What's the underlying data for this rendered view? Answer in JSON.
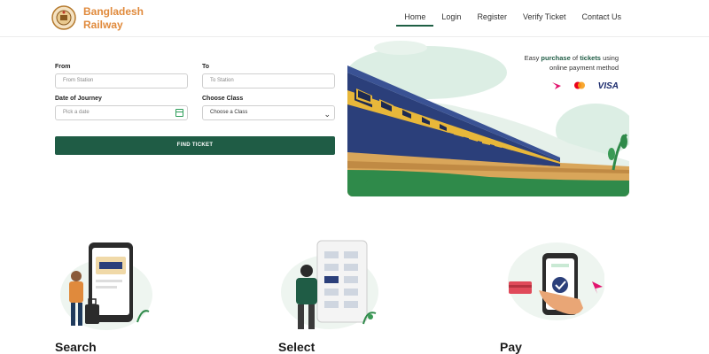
{
  "brand": {
    "line1": "Bangladesh",
    "line2": "Railway"
  },
  "nav": [
    {
      "label": "Home",
      "active": true
    },
    {
      "label": "Login"
    },
    {
      "label": "Register"
    },
    {
      "label": "Verify Ticket"
    },
    {
      "label": "Contact Us"
    }
  ],
  "form": {
    "from_label": "From",
    "from_placeholder": "From Station",
    "to_label": "To",
    "to_placeholder": "To Station",
    "date_label": "Date of Journey",
    "date_placeholder": "Pick a date",
    "class_label": "Choose Class",
    "class_value": "Choose a Class",
    "submit_label": "FIND TICKET"
  },
  "hero": {
    "text_pre": "Easy ",
    "text_purchase": "purchase",
    "text_of": " of ",
    "text_tickets": "tickets",
    "text_using": " using",
    "text_line2": "online payment method",
    "visa": "VISA"
  },
  "steps": [
    {
      "label": "Search"
    },
    {
      "label": "Select"
    },
    {
      "label": "Pay"
    }
  ],
  "colors": {
    "brand_orange": "#e08a3c",
    "primary_green": "#1f5c45",
    "train_blue": "#2b3f7a",
    "train_yellow": "#e8b73a"
  }
}
